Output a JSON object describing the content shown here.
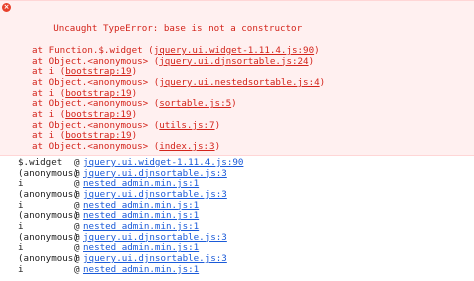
{
  "error": {
    "message": "Uncaught TypeError: base is not a constructor",
    "icon": "error-circle-icon",
    "color": "#d3241b",
    "frames": [
      {
        "prefix": "at Function.$.widget (",
        "link": "jquery.ui.widget-1.11.4.js:90",
        "suffix": ")"
      },
      {
        "prefix": "at Object.<anonymous> (",
        "link": "jquery.ui.djnsortable.js:24",
        "suffix": ")"
      },
      {
        "prefix": "at i (",
        "link": "bootstrap:19",
        "suffix": ")"
      },
      {
        "prefix": "at Object.<anonymous> (",
        "link": "jquery.ui.nestedsortable.js:4",
        "suffix": ")"
      },
      {
        "prefix": "at i (",
        "link": "bootstrap:19",
        "suffix": ")"
      },
      {
        "prefix": "at Object.<anonymous> (",
        "link": "sortable.js:5",
        "suffix": ")"
      },
      {
        "prefix": "at i (",
        "link": "bootstrap:19",
        "suffix": ")"
      },
      {
        "prefix": "at Object.<anonymous> (",
        "link": "utils.js:7",
        "suffix": ")"
      },
      {
        "prefix": "at i (",
        "link": "bootstrap:19",
        "suffix": ")"
      },
      {
        "prefix": "at Object.<anonymous> (",
        "link": "index.js:3",
        "suffix": ")"
      }
    ]
  },
  "stack": [
    {
      "fn": "$.widget",
      "at": "@",
      "link": "jquery.ui.widget-1.11.4.js:90"
    },
    {
      "fn": "(anonymous)",
      "at": "@",
      "link": "jquery.ui.djnsortable.js:3"
    },
    {
      "fn": "i",
      "at": "@",
      "link": "nested_admin.min.js:1"
    },
    {
      "fn": "(anonymous)",
      "at": "@",
      "link": "jquery.ui.djnsortable.js:3"
    },
    {
      "fn": "i",
      "at": "@",
      "link": "nested_admin.min.js:1"
    },
    {
      "fn": "(anonymous)",
      "at": "@",
      "link": "nested_admin.min.js:1"
    },
    {
      "fn": "i",
      "at": "@",
      "link": "nested_admin.min.js:1"
    },
    {
      "fn": "(anonymous)",
      "at": "@",
      "link": "jquery.ui.djnsortable.js:3"
    },
    {
      "fn": "i",
      "at": "@",
      "link": "nested_admin.min.js:1"
    },
    {
      "fn": "(anonymous)",
      "at": "@",
      "link": "jquery.ui.djnsortable.js:3"
    },
    {
      "fn": "i",
      "at": "@",
      "link": "nested_admin.min.js:1"
    }
  ]
}
